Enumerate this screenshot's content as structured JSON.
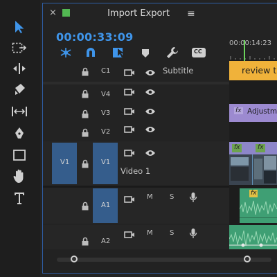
{
  "panel": {
    "title": "Import Export",
    "close_glyph": "×",
    "menu_glyph": "≡",
    "timecode": "00:00:33:09",
    "ruler_timecode": "00:00:14:23"
  },
  "tools": [
    "selection-tool",
    "track-select-forward-tool",
    "ripple-edit-tool",
    "razor-tool",
    "slip-tool",
    "pen-tool",
    "rectangle-tool",
    "hand-tool",
    "type-tool"
  ],
  "timeline_buttons": [
    "snap-icon",
    "linked-selection-icon",
    "insert-icon",
    "add-marker-icon",
    "settings-wrench-icon",
    "captions-icon"
  ],
  "captions_label": "CC",
  "tracks": {
    "c1": {
      "id": "C1",
      "name": "Subtitle"
    },
    "v4": {
      "id": "V4"
    },
    "v3": {
      "id": "V3"
    },
    "v2": {
      "id": "V2"
    },
    "v1": {
      "id": "V1",
      "target": "V1",
      "name": "Video 1"
    },
    "a1": {
      "id": "A1",
      "mute": "M",
      "solo": "S"
    },
    "a2": {
      "id": "A2",
      "mute": "M",
      "solo": "S"
    }
  },
  "clips": {
    "caption_text": "review t",
    "adjustment_text": "Adjustme",
    "fx_label": "fx"
  },
  "colors": {
    "accent_blue": "#3f95ea",
    "target_blue": "#355d8c",
    "caption_clip": "#f0b23a",
    "adjustment_clip": "#9c8ad0",
    "audio_clip": "#3f9f74",
    "playhead_green": "#6bd35b"
  }
}
